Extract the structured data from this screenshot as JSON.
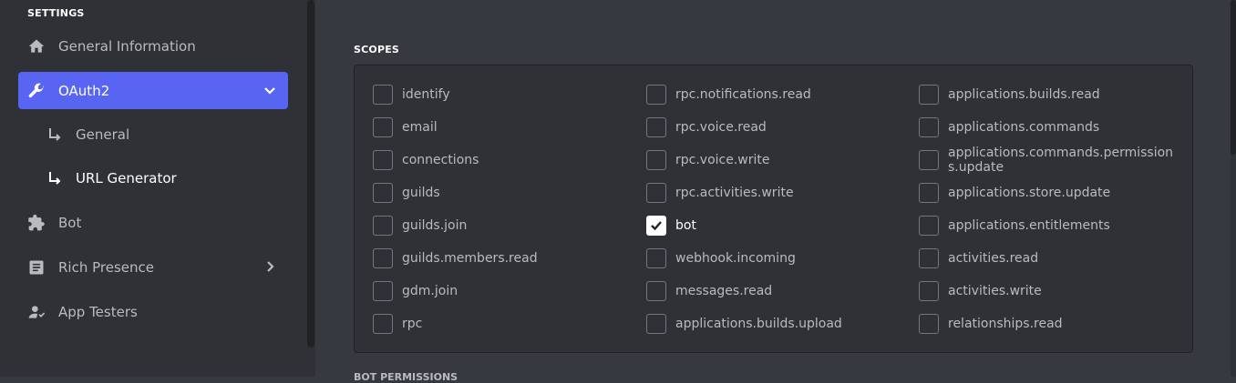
{
  "sidebar": {
    "section_title": "SETTINGS",
    "items": [
      {
        "label": "General Information",
        "icon": "home-icon"
      },
      {
        "label": "OAuth2",
        "icon": "wrench-icon",
        "active": true,
        "expanded": true
      },
      {
        "label": "Bot",
        "icon": "puzzle-icon"
      },
      {
        "label": "Rich Presence",
        "icon": "document-icon",
        "has_submenu": true
      },
      {
        "label": "App Testers",
        "icon": "user-icon"
      }
    ],
    "subitems": [
      {
        "label": "General"
      },
      {
        "label": "URL Generator",
        "selected": true
      }
    ]
  },
  "scopes": {
    "title": "SCOPES",
    "columns": [
      [
        {
          "label": "identify",
          "checked": false
        },
        {
          "label": "email",
          "checked": false
        },
        {
          "label": "connections",
          "checked": false
        },
        {
          "label": "guilds",
          "checked": false
        },
        {
          "label": "guilds.join",
          "checked": false
        },
        {
          "label": "guilds.members.read",
          "checked": false
        },
        {
          "label": "gdm.join",
          "checked": false
        },
        {
          "label": "rpc",
          "checked": false
        }
      ],
      [
        {
          "label": "rpc.notifications.read",
          "checked": false
        },
        {
          "label": "rpc.voice.read",
          "checked": false
        },
        {
          "label": "rpc.voice.write",
          "checked": false
        },
        {
          "label": "rpc.activities.write",
          "checked": false
        },
        {
          "label": "bot",
          "checked": true
        },
        {
          "label": "webhook.incoming",
          "checked": false
        },
        {
          "label": "messages.read",
          "checked": false
        },
        {
          "label": "applications.builds.upload",
          "checked": false
        }
      ],
      [
        {
          "label": "applications.builds.read",
          "checked": false
        },
        {
          "label": "applications.commands",
          "checked": false
        },
        {
          "label": "applications.commands.permissions.update",
          "checked": false
        },
        {
          "label": "applications.store.update",
          "checked": false
        },
        {
          "label": "applications.entitlements",
          "checked": false
        },
        {
          "label": "activities.read",
          "checked": false
        },
        {
          "label": "activities.write",
          "checked": false
        },
        {
          "label": "relationships.read",
          "checked": false
        }
      ]
    ]
  },
  "next_section_title": "BOT PERMISSIONS",
  "colors": {
    "accent": "#5865f2",
    "sidebar_bg": "#2f3136",
    "main_bg": "#36393f"
  }
}
